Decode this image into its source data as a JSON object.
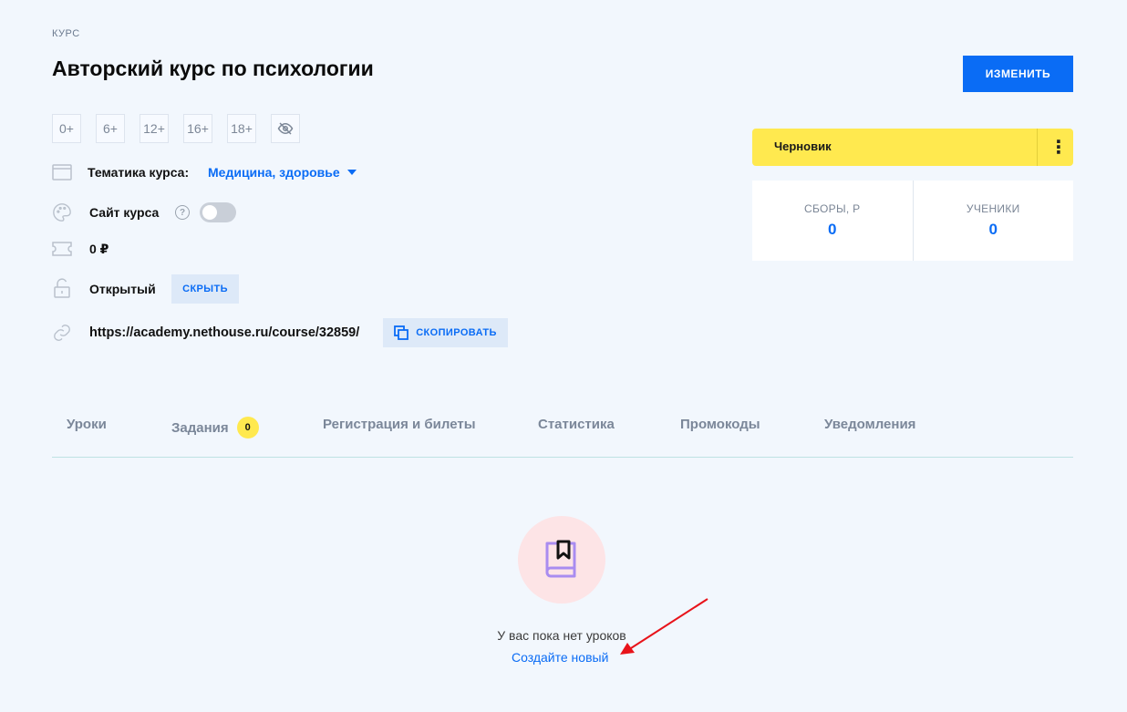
{
  "header": {
    "breadcrumb": "КУРС",
    "title": "Авторский курс по психологии",
    "edit_label": "ИЗМЕНИТЬ"
  },
  "age_ratings": [
    "0+",
    "6+",
    "12+",
    "16+",
    "18+"
  ],
  "topic": {
    "label": "Тематика курса:",
    "value": "Медицина, здоровье"
  },
  "site": {
    "label": "Сайт курса",
    "help": "?",
    "enabled": false
  },
  "price": {
    "value": "0 ₽"
  },
  "access": {
    "label": "Открытый",
    "hide_label": "СКРЫТЬ"
  },
  "link": {
    "url": "https://academy.nethouse.ru/course/32859/",
    "copy_label": "СКОПИРОВАТЬ"
  },
  "status": {
    "label": "Черновик",
    "menu": "⋮",
    "color": "#ffe94f"
  },
  "stats": [
    {
      "label": "СБОРЫ, Р",
      "value": "0"
    },
    {
      "label": "УЧЕНИКИ",
      "value": "0"
    }
  ],
  "tabs": [
    {
      "label": "Уроки"
    },
    {
      "label": "Задания",
      "badge": "0"
    },
    {
      "label": "Регистрация и билеты"
    },
    {
      "label": "Статистика"
    },
    {
      "label": "Промокоды"
    },
    {
      "label": "Уведомления"
    }
  ],
  "empty_state": {
    "text": "У вас пока нет уроков",
    "link": "Создайте новый"
  },
  "colors": {
    "accent": "#0a6cf5",
    "background": "#f2f7fd",
    "annotation": "#e8131a"
  }
}
